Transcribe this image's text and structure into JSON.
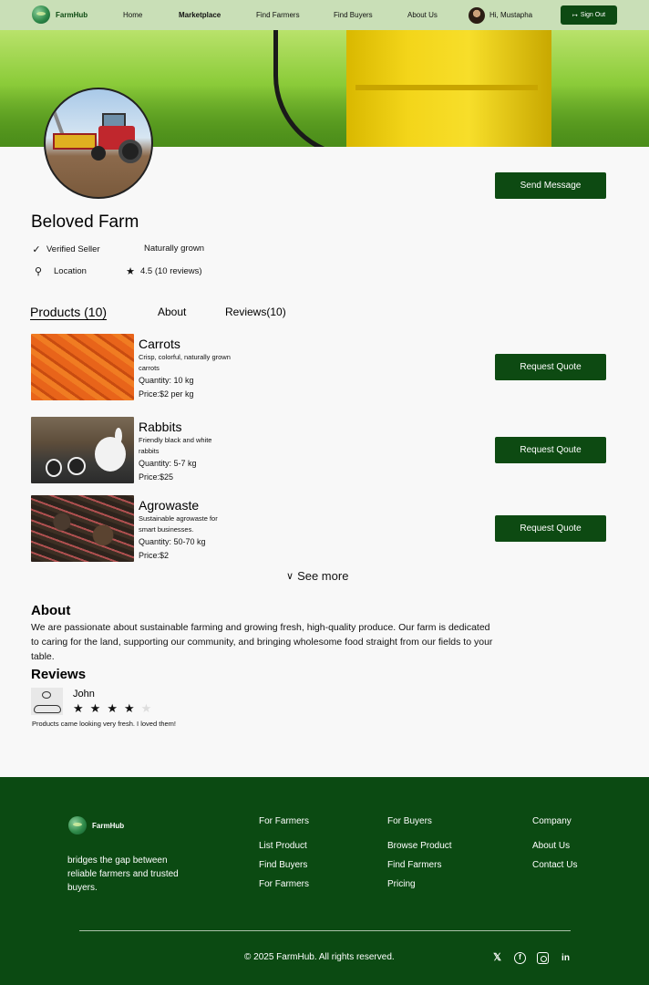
{
  "nav": {
    "brand": "FarmHub",
    "links": [
      "Home",
      "Marketplace",
      "Find Farmers",
      "Find Buyers",
      "About Us"
    ],
    "greeting": "Hi, Mustapha",
    "signout": "Sign Out"
  },
  "profile": {
    "send_message": "Send Message",
    "name": "Beloved Farm",
    "verified": "Verified Seller",
    "tag": "Naturally grown",
    "location": "Location",
    "rating": "4.5 (10 reviews)"
  },
  "tabs": {
    "products": "Products (10)",
    "about": "About",
    "reviews": "Reviews(10)"
  },
  "products": [
    {
      "title": "Carrots",
      "desc": "Crisp, colorful, naturally grown carrots",
      "qty": "Quantity: 10 kg",
      "price": "Price:$2 per kg",
      "button": "Request Quote"
    },
    {
      "title": "Rabbits",
      "desc": "Friendly black and white rabbits",
      "qty": "Quantity: 5-7 kg",
      "price": "Price:$25",
      "button": "Request Qoute"
    },
    {
      "title": "Agrowaste",
      "desc": "Sustainable agrowaste for smart businesses.",
      "qty": "Quantity: 50-70 kg",
      "price": "Price:$2",
      "button": "Request Quote"
    }
  ],
  "see_more": "See more",
  "about": {
    "heading": "About",
    "text": "We are passionate about sustainable farming and growing fresh, high-quality produce. Our farm is dedicated to caring for the land, supporting our community, and bringing wholesome food straight from our fields to your table."
  },
  "reviews": {
    "heading": "Reviews",
    "items": [
      {
        "name": "John",
        "rating": 4,
        "max": 5,
        "text": "Products came looking very fresh. I loved them!"
      }
    ]
  },
  "footer": {
    "brand": "FarmHub",
    "tagline": "bridges the gap between reliable farmers and trusted buyers.",
    "cols": [
      {
        "heading": "For Farmers",
        "links": [
          "List Product",
          "Find Buyers",
          "For Farmers"
        ]
      },
      {
        "heading": "For Buyers",
        "links": [
          "Browse Product",
          "Find Farmers",
          "Pricing"
        ]
      },
      {
        "heading": "Company",
        "links": [
          "About Us",
          "Contact Us"
        ]
      }
    ],
    "copyright": "© 2025 FarmHub. All rights reserved.",
    "social": [
      "x-icon",
      "facebook-icon",
      "instagram-icon",
      "linkedin-icon"
    ]
  },
  "colors": {
    "primary": "#0d4a12",
    "nav_bg": "#c9dfb7",
    "footer_bg": "#0b4a12"
  }
}
